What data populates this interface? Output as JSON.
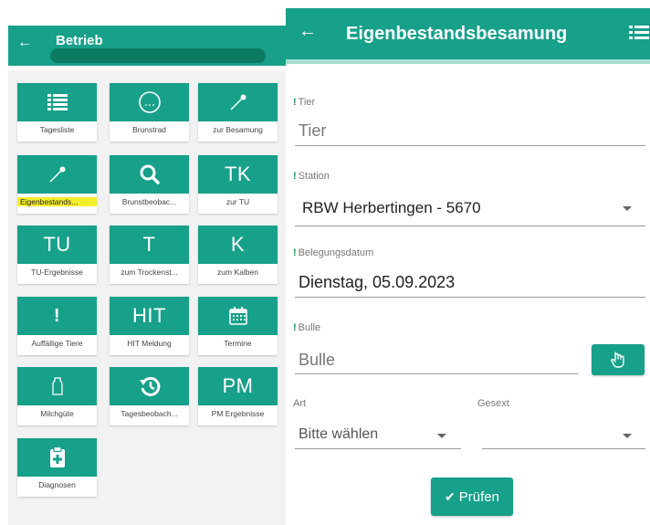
{
  "left_panel": {
    "title": "Betrieb",
    "back_icon": "arrow-left-icon",
    "tiles": [
      {
        "icon": "list-icon",
        "label": "Tagesliste"
      },
      {
        "icon": "circle-dots-icon",
        "label": "Brunstrad"
      },
      {
        "icon": "insemination-icon",
        "label": "zur Besamung"
      },
      {
        "icon": "insemination-icon",
        "label": "Eigenbestands...",
        "highlighted": true
      },
      {
        "icon": "search-icon",
        "label": "Brunstbeobac..."
      },
      {
        "icon_text": "TK",
        "label": "zur TU"
      },
      {
        "icon_text": "TU",
        "label": "TU-Ergebnisse"
      },
      {
        "icon_text": "T",
        "label": "zum Trockenst..."
      },
      {
        "icon_text": "K",
        "label": "zum Kalben"
      },
      {
        "icon_text": "!",
        "label": "Auffällige Tiere"
      },
      {
        "icon_text": "HIT",
        "label": "HIT Meldung"
      },
      {
        "icon": "calendar-icon",
        "label": "Termine"
      },
      {
        "icon": "milk-bottle-icon",
        "label": "Milchgüte"
      },
      {
        "icon": "history-icon",
        "label": "Tagesbeobach..."
      },
      {
        "icon_text": "PM",
        "label": "PM Ergebnisse"
      },
      {
        "icon": "clipboard-plus-icon",
        "label": "Diagnosen"
      }
    ]
  },
  "right_panel": {
    "title": "Eigenbestandsbesamung",
    "back_icon": "arrow-left-icon",
    "menu_icon": "list-menu-icon",
    "fields": {
      "tier": {
        "label": "Tier",
        "required": true,
        "placeholder": "Tier"
      },
      "station": {
        "label": "Station",
        "required": true,
        "value": "RBW Herbertingen - 5670"
      },
      "belegungsdatum": {
        "label": "Belegungsdatum",
        "required": true,
        "value": "Dienstag, 05.09.2023"
      },
      "bulle": {
        "label": "Bulle",
        "required": true,
        "placeholder": "Bulle"
      },
      "art": {
        "label": "Art",
        "value": "Bitte wählen"
      },
      "gesext": {
        "label": "Gesext",
        "value": ""
      }
    },
    "scan_icon": "hand-pointer-icon",
    "check_icon": "checkmark-icon",
    "submit_label": "Prüfen",
    "required_mark": "!"
  },
  "colors": {
    "primary": "#17a08a",
    "primary_dark": "#0d7a62",
    "highlight": "#f4ef2a",
    "required_mark": "#1a9a4a"
  }
}
